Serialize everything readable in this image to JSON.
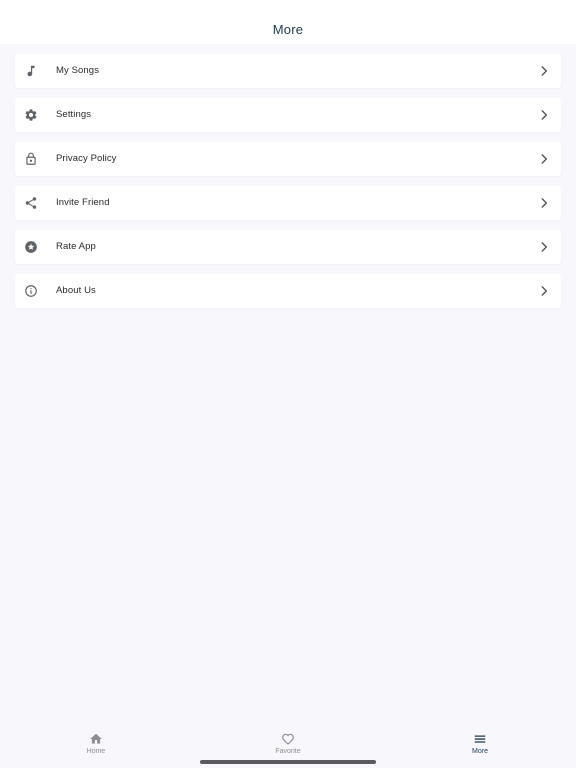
{
  "header": {
    "title": "More"
  },
  "menu": {
    "items": [
      {
        "label": "My Songs",
        "icon": "music-note-icon"
      },
      {
        "label": "Settings",
        "icon": "gear-icon"
      },
      {
        "label": "Privacy Policy",
        "icon": "lock-icon"
      },
      {
        "label": "Invite Friend",
        "icon": "share-icon"
      },
      {
        "label": "Rate App",
        "icon": "star-icon"
      },
      {
        "label": "About Us",
        "icon": "info-icon"
      }
    ]
  },
  "tabbar": {
    "tabs": [
      {
        "label": "Home",
        "icon": "home-icon"
      },
      {
        "label": "Favorite",
        "icon": "heart-icon"
      },
      {
        "label": "More",
        "icon": "menu-icon",
        "active": true
      }
    ]
  },
  "colors": {
    "background": "#f8f7fb",
    "title": "#1e3a52",
    "icon": "#5f6368",
    "inactive_tab": "#8e8e93"
  }
}
